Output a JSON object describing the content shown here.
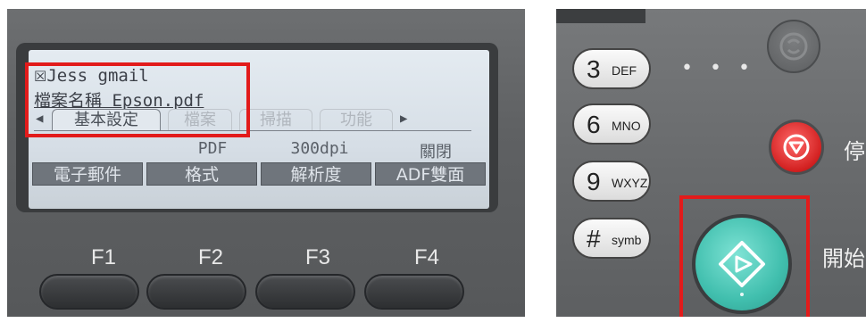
{
  "lcd": {
    "line1": "Jess gmail",
    "line2": "檔案名稱 Epson.pdf",
    "tabs": [
      "基本設定",
      "檔案",
      "掃描",
      "功能"
    ],
    "values": [
      "PDF",
      "300dpi",
      "關閉"
    ],
    "softkeys": [
      "電子郵件",
      "格式",
      "解析度",
      "ADF雙面"
    ]
  },
  "function_keys": [
    "F1",
    "F2",
    "F3",
    "F4"
  ],
  "keypad": {
    "keys": [
      {
        "num": "3",
        "sub": "DEF"
      },
      {
        "num": "6",
        "sub": "MNO"
      },
      {
        "num": "9",
        "sub": "WXYZ"
      },
      {
        "num": "#",
        "sub": "symb"
      }
    ],
    "dots": "• • •",
    "stop_label": "停",
    "start_label": "開始"
  },
  "colors": {
    "highlight": "#e21b1b",
    "start_button": "#41bfae",
    "stop_button": "#d22020"
  },
  "icons": [
    "mail-icon",
    "left-arrow-icon",
    "right-arrow-icon",
    "power-icon",
    "stop-icon",
    "start-diamond-icon"
  ]
}
